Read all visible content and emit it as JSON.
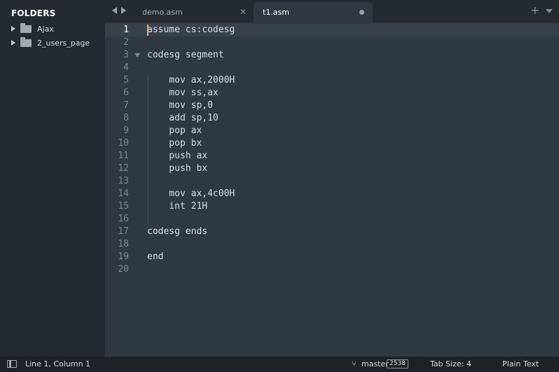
{
  "sidebar": {
    "title": "FOLDERS",
    "items": [
      {
        "label": "Ajax",
        "icon": "folder-icon"
      },
      {
        "label": "2_users_page",
        "icon": "folder-icon"
      }
    ]
  },
  "tabs": {
    "inactive": {
      "label": "demo.asm",
      "close": "✕"
    },
    "active": {
      "label": "t1.asm"
    },
    "add": "+"
  },
  "editor": {
    "current_line": 1,
    "line_numbers": [
      "1",
      "2",
      "3",
      "4",
      "5",
      "6",
      "7",
      "8",
      "9",
      "10",
      "11",
      "12",
      "13",
      "14",
      "15",
      "16",
      "17",
      "18",
      "19",
      "20"
    ],
    "lines": [
      "assume cs:codesg",
      "",
      "codesg segment",
      "",
      "    mov ax,2000H",
      "    mov ss,ax",
      "    mov sp,0",
      "    add sp,10",
      "    pop ax",
      "    pop bx",
      "    push ax",
      "    push bx",
      "",
      "    mov ax,4c00H",
      "    int 21H",
      "",
      "codesg ends",
      "",
      "end",
      ""
    ]
  },
  "statusbar": {
    "position": "Line 1, Column 1",
    "branch": "master",
    "changes": "2538",
    "tab_size": "Tab Size: 4",
    "syntax": "Plain Text"
  },
  "colors": {
    "editor_bg": "#303841",
    "sidebar_bg": "#252a30",
    "cursor": "#f9ae58",
    "text": "#d8dee9",
    "line_number": "#7c8893"
  }
}
